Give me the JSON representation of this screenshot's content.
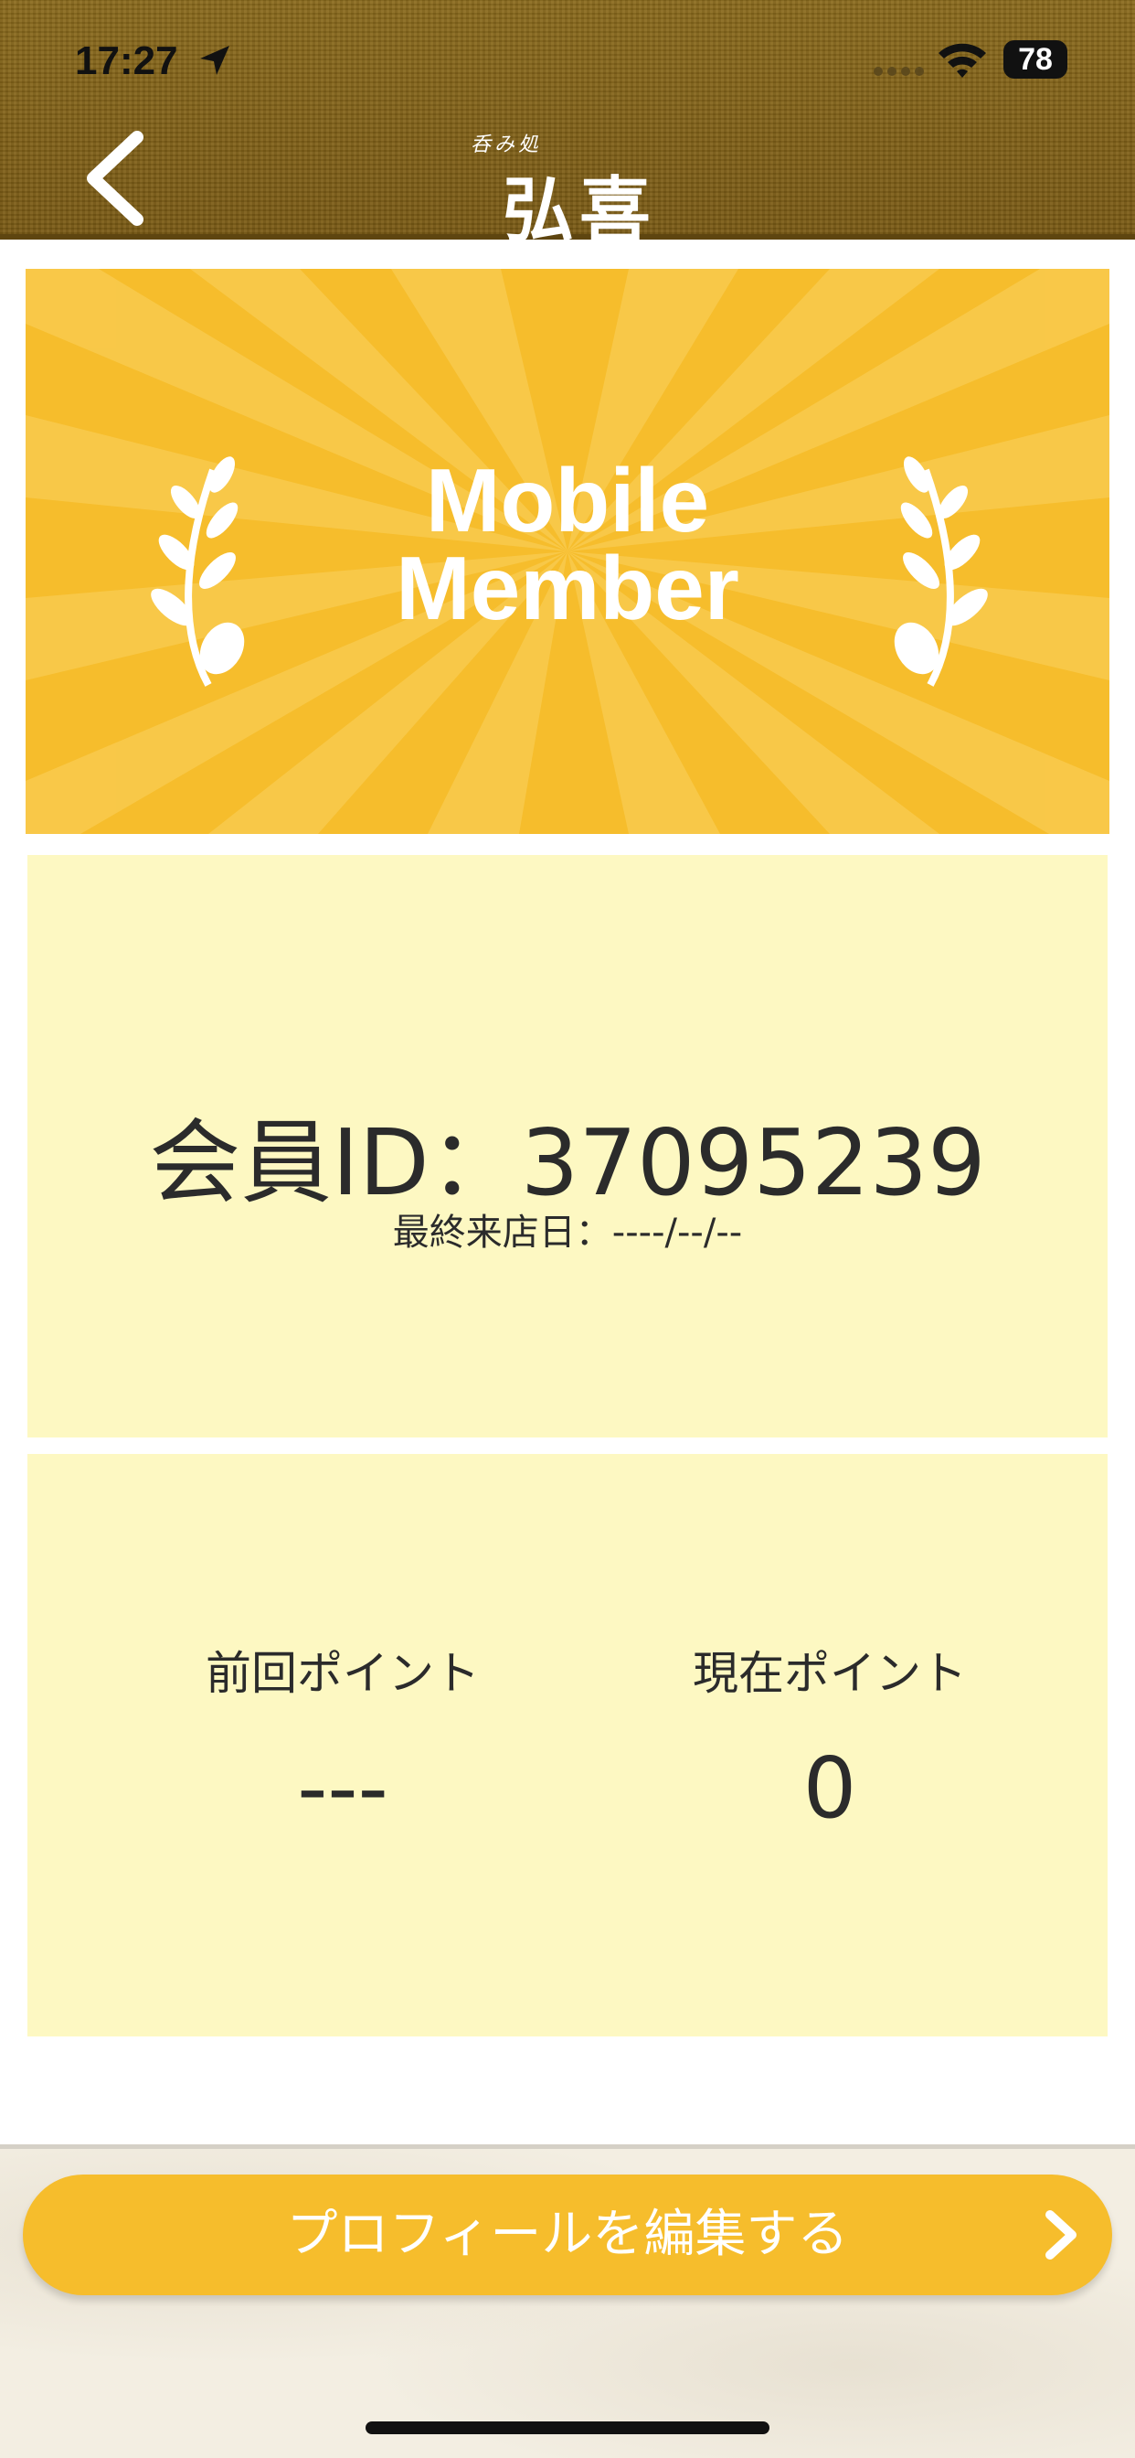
{
  "status_bar": {
    "time": "17:27",
    "battery": "78"
  },
  "header": {
    "logo_small": "呑み処",
    "logo_main": "弘喜",
    "back_icon": "chevron-left-icon"
  },
  "banner": {
    "title_line1": "Mobile",
    "title_line2": "Member",
    "color": "#f6bd2c"
  },
  "member": {
    "id_text": "会員ID：37095239",
    "last_visit": "最終来店日：----/--/--"
  },
  "points": {
    "previous_label": "前回ポイント",
    "previous_value": "---",
    "current_label": "現在ポイント",
    "current_value": "0"
  },
  "footer": {
    "edit_profile_label": "プロフィールを編集する",
    "edit_icon": "chevron-right-icon"
  },
  "colors": {
    "accent": "#f6bd2c",
    "card": "#fdf8c2",
    "header": "#7a5a14"
  }
}
